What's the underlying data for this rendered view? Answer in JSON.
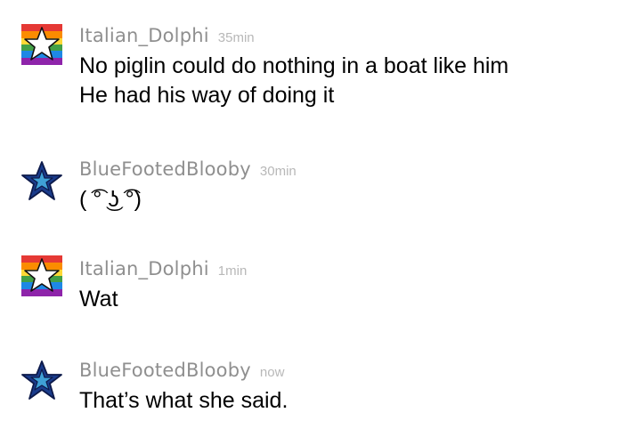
{
  "messages": [
    {
      "username": "Italian_Dolphi",
      "time": "35min",
      "avatar_icon": "rainbow-star-icon",
      "lines": [
        "No piglin could do nothing in a boat like him",
        "He had his way of doing it"
      ]
    },
    {
      "username": "BlueFootedBlooby",
      "time": "30min",
      "avatar_icon": "blue-star-icon",
      "lines": [
        "( ͡° ͜ʖ ͡°)"
      ]
    },
    {
      "username": "Italian_Dolphi",
      "time": "1min",
      "avatar_icon": "rainbow-star-icon",
      "lines": [
        "Wat"
      ]
    },
    {
      "username": "BlueFootedBlooby",
      "time": "now",
      "avatar_icon": "blue-star-icon",
      "lines": [
        "That’s what she said."
      ]
    }
  ],
  "colors": {
    "username": "#8f8f8f",
    "time": "#b8b8b8",
    "text": "#000000",
    "blue_star": "#1a3c8c",
    "blue_star_outline": "#0d1a4a",
    "rainbow": [
      "#e53935",
      "#fb8c00",
      "#fdd835",
      "#43a047",
      "#1e88e5",
      "#8e24aa"
    ]
  }
}
